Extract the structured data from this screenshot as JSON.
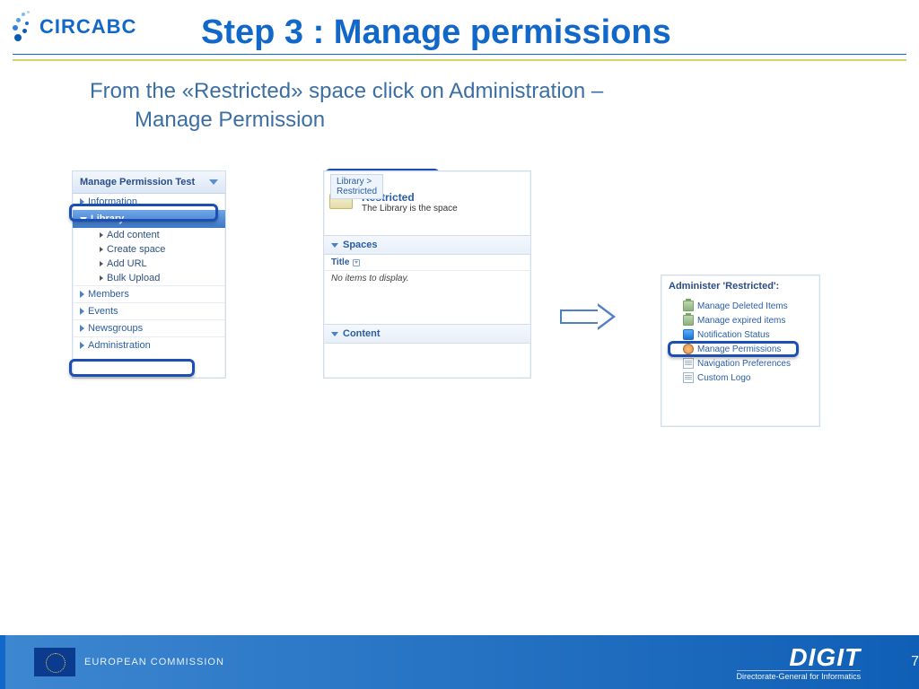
{
  "brand": "CIRCABC",
  "title": "Step 3 : Manage permissions",
  "instruction_line1": "From the «Restricted» space click on Administration –",
  "instruction_line2": "Manage Permission",
  "left_panel": {
    "header": "Manage Permission Test",
    "items": {
      "information": "Information",
      "library": "Library",
      "lib_sub": {
        "add_content": "Add content",
        "create_space": "Create space",
        "add_url": "Add URL",
        "bulk_upload": "Bulk Upload"
      },
      "members": "Members",
      "events": "Events",
      "newsgroups": "Newsgroups",
      "administration": "Administration"
    }
  },
  "mid_panel": {
    "breadcrumb": "Library > Restricted",
    "space_title": "Restricted",
    "space_desc": "The Library is the space",
    "spaces_header": "Spaces",
    "title_col": "Title",
    "no_items": "No items to display.",
    "content_header": "Content"
  },
  "right_panel": {
    "title": "Administer 'Restricted':",
    "items": {
      "deleted": "Manage Deleted Items",
      "expired": "Manage expired items",
      "notif": "Notification Status",
      "perms": "Manage Permissions",
      "navpref": "Navigation Preferences",
      "logo": "Custom Logo"
    }
  },
  "footer": {
    "ec": "EUROPEAN COMMISSION",
    "digit": "DIGIT",
    "dgi": "Directorate-General for Informatics",
    "page": "7"
  }
}
